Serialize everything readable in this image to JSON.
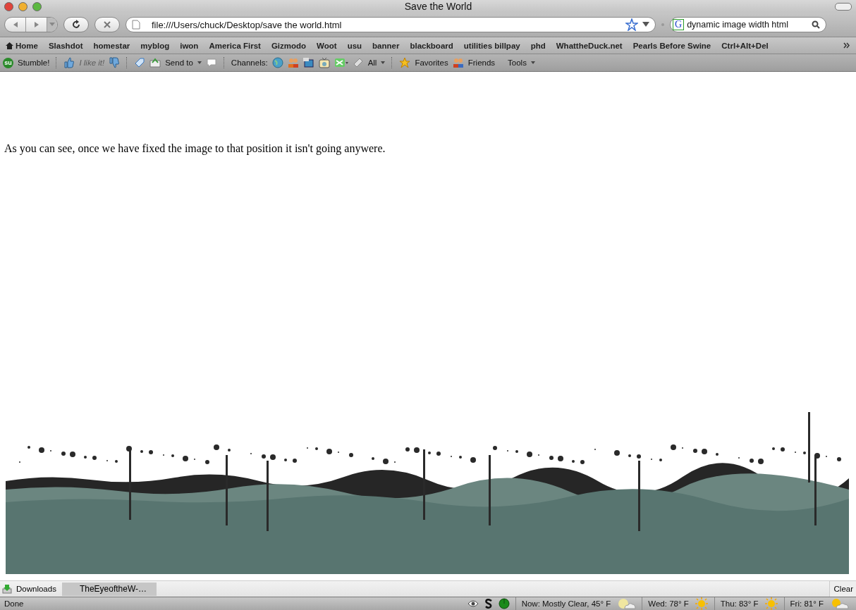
{
  "window": {
    "title": "Save the World"
  },
  "navigation": {
    "url": "file:///Users/chuck/Desktop/save the world.html",
    "search_engine": "G",
    "search_value": "dynamic image width html"
  },
  "bookmarks": [
    {
      "label": "Home",
      "kind": "home"
    },
    {
      "label": "Slashdot",
      "kind": "plain"
    },
    {
      "label": "homestar",
      "kind": "plain"
    },
    {
      "label": "myblog",
      "kind": "plain"
    },
    {
      "label": "iwon",
      "kind": "plain"
    },
    {
      "label": "America First",
      "kind": "plain"
    },
    {
      "label": "Gizmodo",
      "kind": "plain"
    },
    {
      "label": "Woot",
      "kind": "plain"
    },
    {
      "label": "usu",
      "kind": "plain"
    },
    {
      "label": "banner",
      "kind": "plain"
    },
    {
      "label": "blackboard",
      "kind": "plain"
    },
    {
      "label": "utilities billpay",
      "kind": "plain"
    },
    {
      "label": "phd",
      "kind": "plain"
    },
    {
      "label": "WhattheDuck.net",
      "kind": "plain"
    },
    {
      "label": "Pearls Before Swine",
      "kind": "plain"
    },
    {
      "label": "Ctrl+Alt+Del",
      "kind": "plain"
    }
  ],
  "stumble_toolbar": {
    "logo": "su",
    "stumble": "Stumble!",
    "like": {
      "label": "I like it!",
      "disabled": true
    },
    "send_to": "Send to",
    "channels_label": "Channels:",
    "all": "All",
    "favorites": "Favorites",
    "friends": "Friends",
    "tools": "Tools"
  },
  "page": {
    "text": "As you can see, once we have fixed the image to that position it isn't going anywere."
  },
  "downloads_bar": {
    "label": "Downloads",
    "item": "TheEyeoftheW-…",
    "clear": "Clear"
  },
  "status_bar": {
    "status": "Done",
    "weather": [
      {
        "text": "Now: Mostly Clear, 45° F",
        "kind": "moon_cloud"
      },
      {
        "text": "Wed: 78° F",
        "kind": "sun"
      },
      {
        "text": "Thu: 83° F",
        "kind": "sun"
      },
      {
        "text": "Fri: 81° F",
        "kind": "sun_cloud"
      }
    ]
  }
}
